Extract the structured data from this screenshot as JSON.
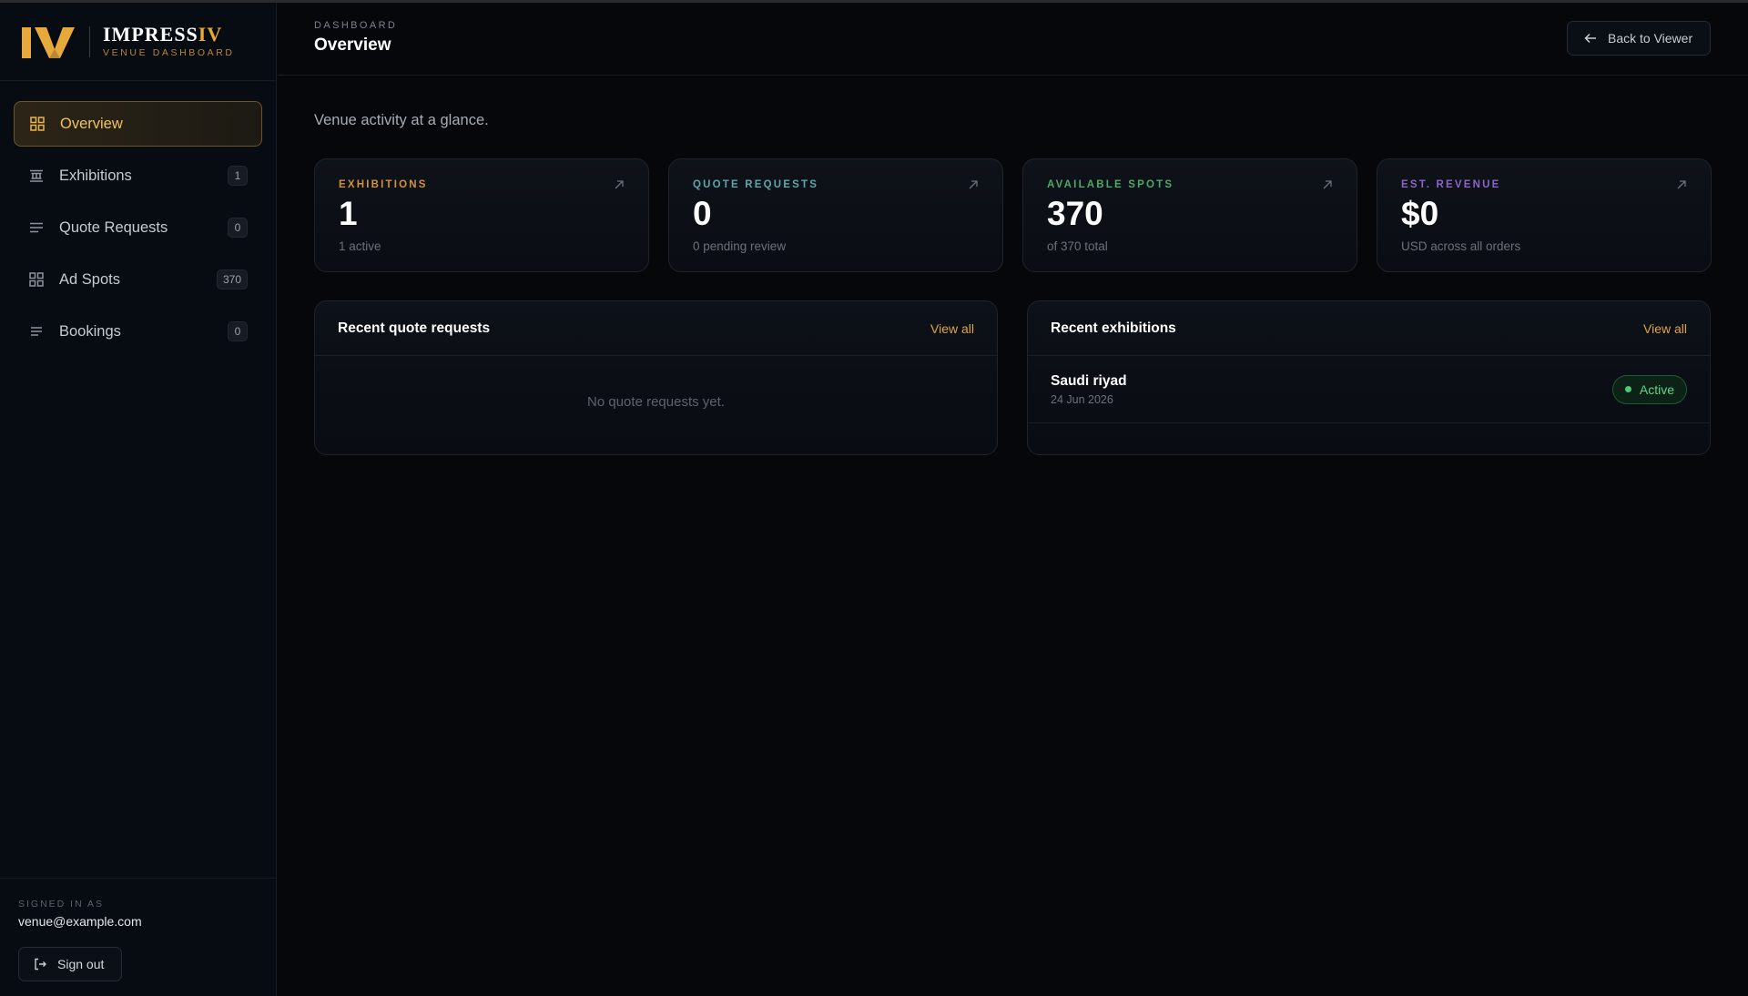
{
  "brand": {
    "name_main": "IMPRESS",
    "name_accent": "IV",
    "subtitle": "VENUE DASHBOARD",
    "mark_colors": {
      "gold": "#e7a93a",
      "dark_gold": "#b7863a"
    }
  },
  "sidebar": {
    "items": [
      {
        "label": "Overview",
        "icon": "grid-icon",
        "count": null,
        "active": true
      },
      {
        "label": "Exhibitions",
        "icon": "building-icon",
        "count": "1"
      },
      {
        "label": "Quote Requests",
        "icon": "list-icon",
        "count": "0"
      },
      {
        "label": "Ad Spots",
        "icon": "grid-icon",
        "count": "370"
      },
      {
        "label": "Bookings",
        "icon": "list-icon",
        "count": "0"
      }
    ],
    "footer": {
      "signed_label": "SIGNED IN AS",
      "email": "venue@example.com",
      "signout_label": "Sign out"
    }
  },
  "header": {
    "breadcrumb": "DASHBOARD",
    "title": "Overview",
    "back_label": "Back to Viewer"
  },
  "intro": "Venue activity at a glance.",
  "stats": [
    {
      "label": "EXHIBITIONS",
      "value": "1",
      "sub": "1 active",
      "color": "#d4913a"
    },
    {
      "label": "QUOTE REQUESTS",
      "value": "0",
      "sub": "0 pending review",
      "color": "#5ea6a8"
    },
    {
      "label": "AVAILABLE SPOTS",
      "value": "370",
      "sub": "of 370 total",
      "color": "#4fa86a"
    },
    {
      "label": "EST. REVENUE",
      "value": "$0",
      "sub": "USD across all orders",
      "color": "#8e63c8"
    }
  ],
  "panels": {
    "quotes": {
      "title": "Recent quote requests",
      "link": "View all",
      "empty": "No quote requests yet."
    },
    "exhibitions": {
      "title": "Recent exhibitions",
      "link": "View all",
      "rows": [
        {
          "name": "Saudi riyad",
          "date": "24 Jun 2026",
          "status": "Active"
        }
      ]
    }
  }
}
